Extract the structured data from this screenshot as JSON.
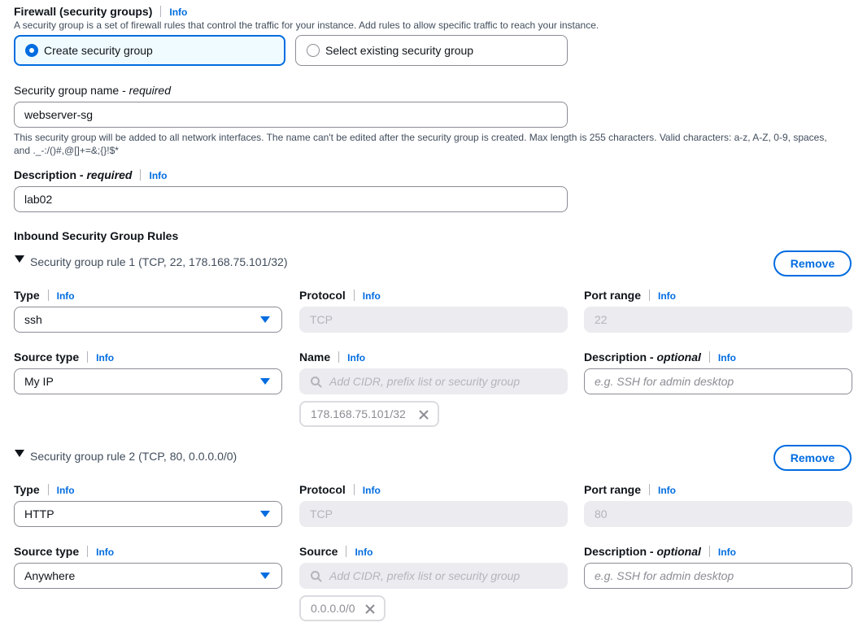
{
  "firewall": {
    "title": "Firewall (security groups)",
    "info": "Info",
    "description": "A security group is a set of firewall rules that control the traffic for your instance. Add rules to allow specific traffic to reach your instance.",
    "options": [
      {
        "label": "Create security group",
        "selected": true
      },
      {
        "label": "Select existing security group",
        "selected": false
      }
    ]
  },
  "sg_name": {
    "label_main": "Security group name - ",
    "label_req": "required",
    "value": "webserver-sg",
    "hint_line1": "This security group will be added to all network interfaces. The name can't be edited after the security group is created. Max length is 255 characters. Valid characters: a-z, A-Z, 0-9, spaces,",
    "hint_line2": "and ._-:/()#,@[]+=&;{}!$*"
  },
  "description": {
    "label_main": "Description - ",
    "label_req": "required",
    "info": "Info",
    "value": "lab02"
  },
  "inbound": {
    "title": "Inbound Security Group Rules",
    "rules": [
      {
        "heading": "Security group rule 1 (TCP, 22, 178.168.75.101/32)",
        "remove": "Remove",
        "type_label": "Type",
        "type_value": "ssh",
        "protocol_label": "Protocol",
        "protocol_value": "TCP",
        "port_label": "Port range",
        "port_value": "22",
        "source_type_label": "Source type",
        "source_type_value": "My IP",
        "name_label": "Name",
        "cidr_placeholder": "Add CIDR, prefix list or security group",
        "desc_label_main": "Description - ",
        "desc_label_opt": "optional",
        "desc_placeholder": "e.g. SSH for admin desktop",
        "token": "178.168.75.101/32"
      },
      {
        "heading": "Security group rule 2 (TCP, 80, 0.0.0.0/0)",
        "remove": "Remove",
        "type_label": "Type",
        "type_value": "HTTP",
        "protocol_label": "Protocol",
        "protocol_value": "TCP",
        "port_label": "Port range",
        "port_value": "80",
        "source_type_label": "Source type",
        "source_type_value": "Anywhere",
        "name_label": "Source",
        "cidr_placeholder": "Add CIDR, prefix list or security group",
        "desc_label_main": "Description - ",
        "desc_label_opt": "optional",
        "desc_placeholder": "e.g. SSH for admin desktop",
        "token": "0.0.0.0/0"
      }
    ]
  },
  "info_label": "Info",
  "colors": {
    "accent": "#006ce0",
    "text": "#0f141a",
    "disabled_bg": "#ebebf0"
  }
}
